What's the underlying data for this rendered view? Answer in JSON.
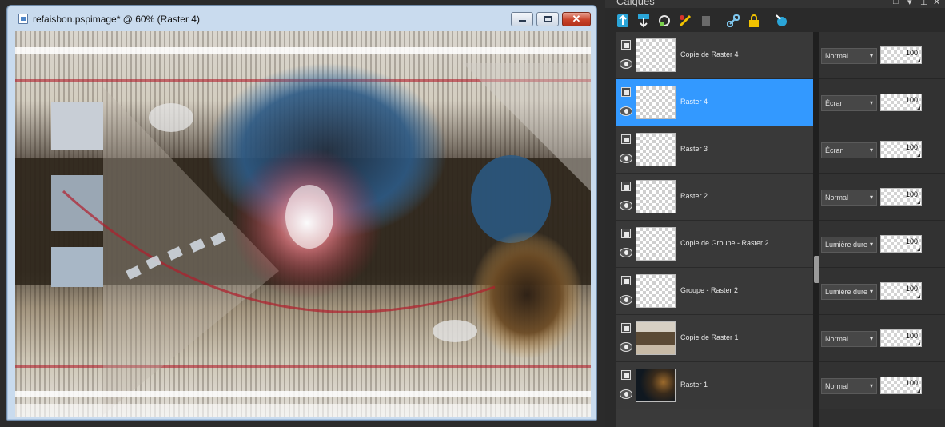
{
  "document": {
    "title": "refaisbon.pspimage* @  60% (Raster 4)",
    "minimize_icon": "minimize-icon",
    "maximize_icon": "maximize-icon",
    "close_icon": "close-icon",
    "close_glyph": "✕"
  },
  "layers_panel": {
    "title": "Calques",
    "header_controls": [
      "□",
      "▾",
      "⊥",
      "✕"
    ],
    "toolbar_icons": [
      "new-raster-layer-icon",
      "new-vector-layer-icon",
      "new-adjustment-layer-icon",
      "layer-style-icon",
      "delete-layer-icon",
      "link-icon",
      "lock-icon",
      "highlight-icon"
    ],
    "accent_color": "#3399ff",
    "layers": [
      {
        "name": "Copie de Raster 4",
        "blend_mode": "Normal",
        "opacity": "100",
        "selected": false,
        "thumb": "transparent"
      },
      {
        "name": "Raster 4",
        "blend_mode": "Écran",
        "opacity": "100",
        "selected": true,
        "thumb": "transparent"
      },
      {
        "name": "Raster 3",
        "blend_mode": "Écran",
        "opacity": "100",
        "selected": false,
        "thumb": "transparent"
      },
      {
        "name": "Raster 2",
        "blend_mode": "Normal",
        "opacity": "100",
        "selected": false,
        "thumb": "transparent"
      },
      {
        "name": "Copie de Groupe - Raster 2",
        "blend_mode": "Lumière dure",
        "opacity": "100",
        "selected": false,
        "thumb": "transparent"
      },
      {
        "name": "Groupe - Raster 2",
        "blend_mode": "Lumière dure",
        "opacity": "100",
        "selected": false,
        "thumb": "transparent"
      },
      {
        "name": "Copie de Raster 1",
        "blend_mode": "Normal",
        "opacity": "100",
        "selected": false,
        "thumb": "photo"
      },
      {
        "name": "Raster 1",
        "blend_mode": "Normal",
        "opacity": "100",
        "selected": false,
        "thumb": "dark"
      }
    ]
  }
}
